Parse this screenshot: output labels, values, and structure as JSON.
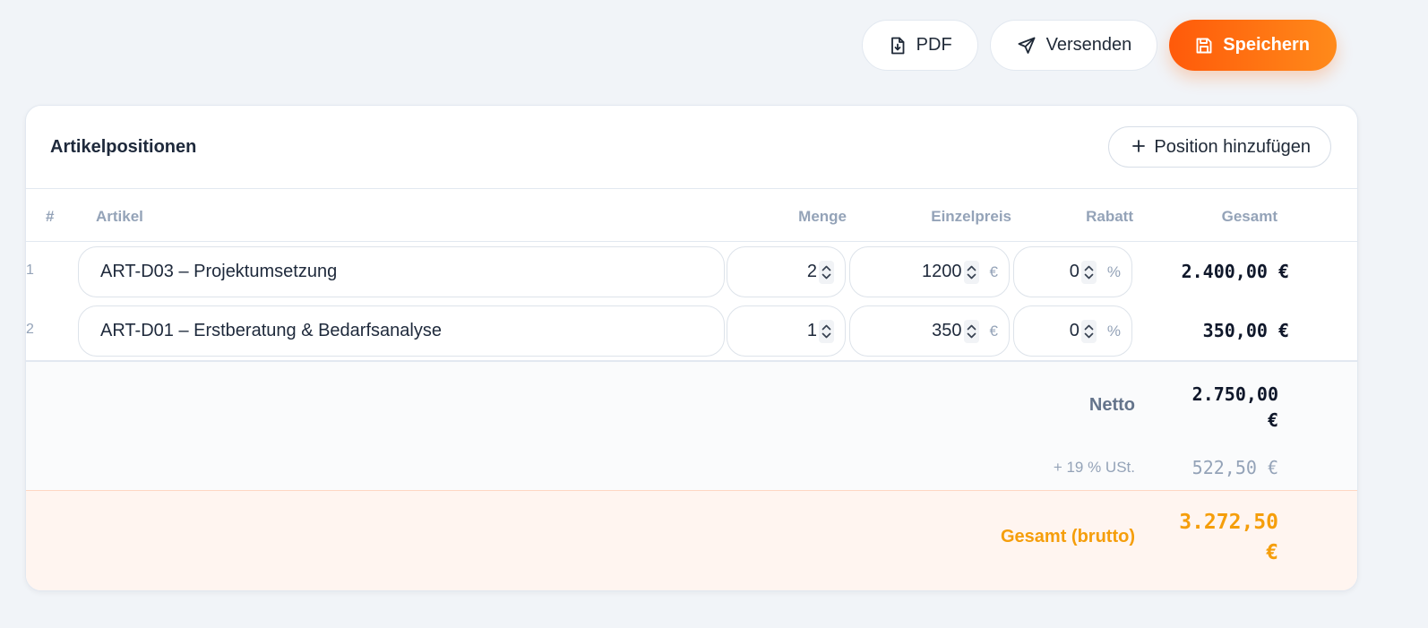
{
  "toolbar": {
    "pdf_label": "PDF",
    "send_label": "Versenden",
    "save_label": "Speichern"
  },
  "card": {
    "title": "Artikelpositionen",
    "add_label": "Position hinzufügen"
  },
  "columns": {
    "index": "#",
    "article": "Artikel",
    "quantity": "Menge",
    "unit_price": "Einzelpreis",
    "discount": "Rabatt",
    "total": "Gesamt"
  },
  "rows": [
    {
      "index": "1",
      "article": "ART-D03 – Projektumsetzung",
      "quantity": "2",
      "unit_price": "1200",
      "currency": "€",
      "discount": "0",
      "discount_unit": "%",
      "total": "2.400,00 €"
    },
    {
      "index": "2",
      "article": "ART-D01 – Erstberatung & Bedarfsanalyse",
      "quantity": "1",
      "unit_price": "350",
      "currency": "€",
      "discount": "0",
      "discount_unit": "%",
      "total": "350,00 €"
    }
  ],
  "totals": {
    "net_label": "Netto",
    "net_value_line1": "2.750,00",
    "net_value_line2": "€",
    "vat_label": "+ 19 % USt.",
    "vat_value": "522,50 €",
    "gross_label": "Gesamt (brutto)",
    "gross_value_line1": "3.272,50",
    "gross_value_line2": "€"
  },
  "colors": {
    "accent": "#ff6a10",
    "gross_text": "#f59e0b",
    "background": "#f1f4f8"
  },
  "icons": {
    "pdf": "file-download-icon",
    "send": "paper-plane-icon",
    "save": "floppy-disk-icon",
    "add": "plus-icon",
    "spin": "chevron-up-down-icon"
  }
}
